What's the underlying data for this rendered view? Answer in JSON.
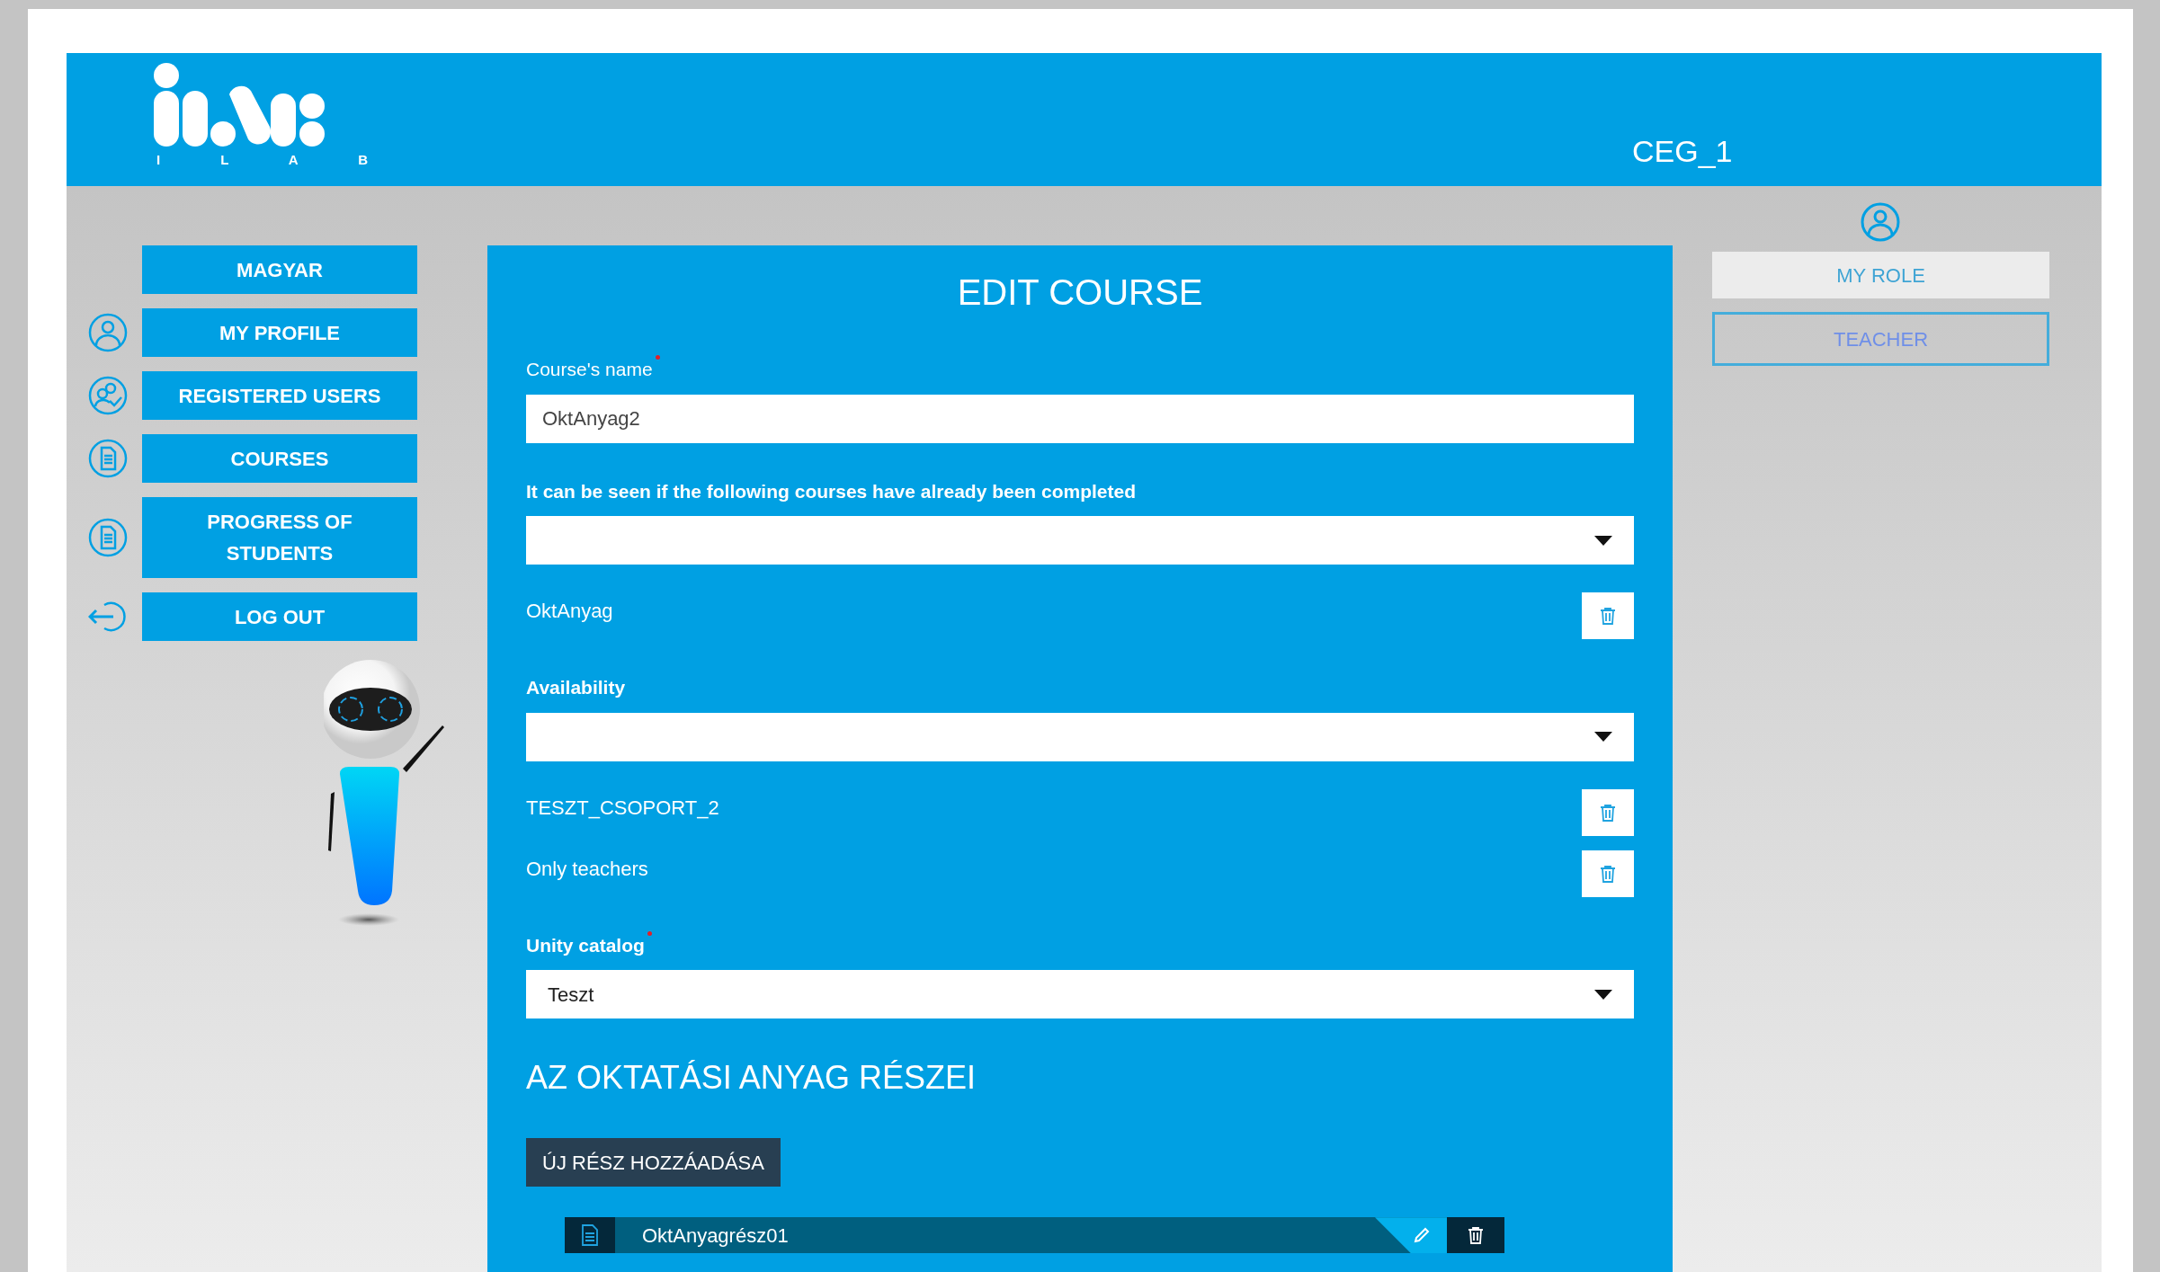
{
  "header": {
    "logo_caption": "I L A B",
    "company": "CEG_1"
  },
  "sidebar": {
    "items": [
      {
        "label": "MAGYAR",
        "kind": "plain"
      },
      {
        "label": "MY PROFILE",
        "kind": "user"
      },
      {
        "label": "REGISTERED USERS",
        "kind": "users"
      },
      {
        "label": "COURSES",
        "kind": "document"
      },
      {
        "label": "PROGRESS OF STUDENTS",
        "kind": "document"
      },
      {
        "label": "LOG OUT",
        "kind": "logout"
      }
    ]
  },
  "form": {
    "title": "EDIT COURSE",
    "fields": [
      {
        "kind": "text",
        "label": "Course's name",
        "required": true,
        "value": "OktAnyag2"
      },
      {
        "kind": "select",
        "label": "It can be seen if the following courses have already been completed",
        "required": false,
        "items": [
          "OktAnyag"
        ]
      },
      {
        "kind": "select",
        "label": "Availability",
        "required": false,
        "items": [
          "TESZT_CSOPORT_2",
          "Only teachers"
        ]
      },
      {
        "kind": "select",
        "label": "Unity catalog",
        "required": true,
        "value": "Teszt"
      }
    ],
    "parts_heading": "AZ OKTATÁSI ANYAG RÉSZEI",
    "add_button": "ÚJ RÉSZ HOZZÁADÁSA",
    "parts": [
      {
        "name": "OktAnyagrész01"
      }
    ]
  },
  "role": {
    "heading": "MY ROLE",
    "value": "TEACHER"
  }
}
